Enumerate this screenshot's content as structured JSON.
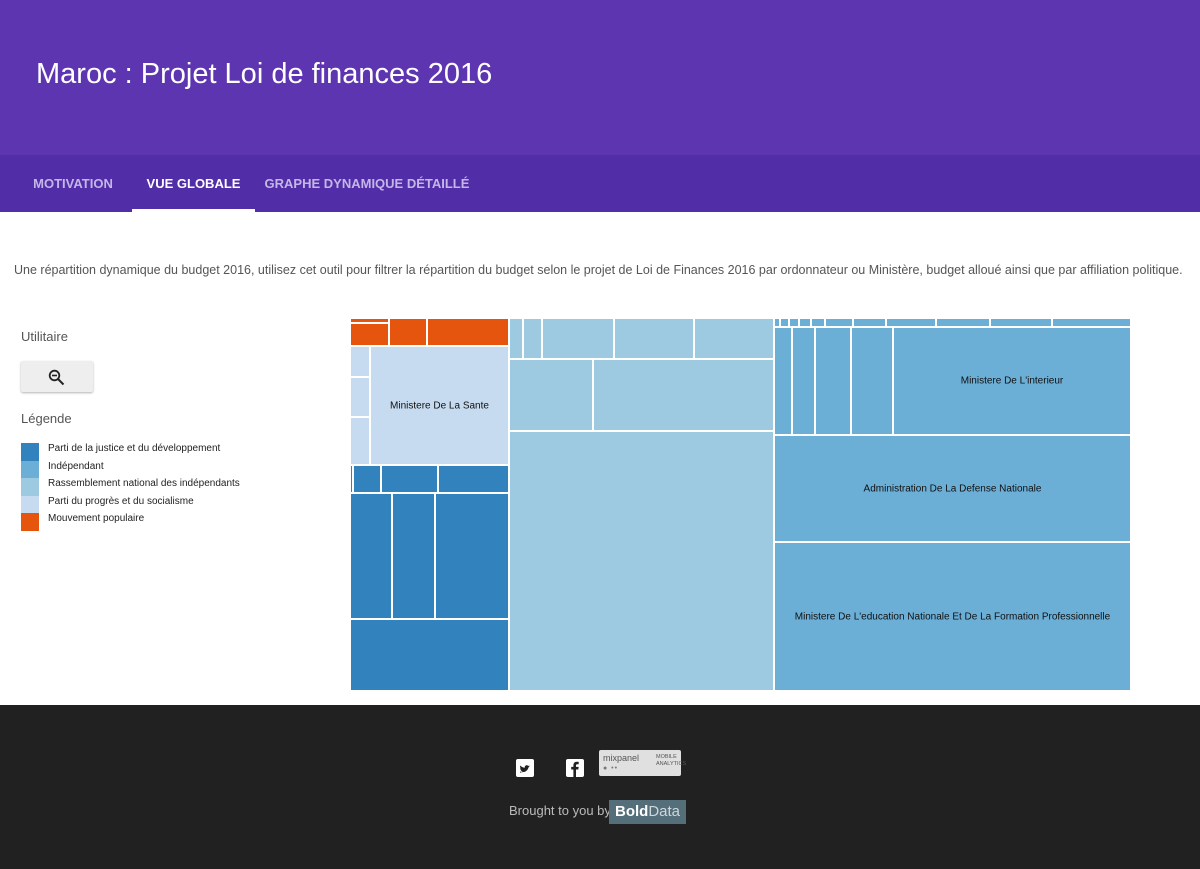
{
  "header": {
    "title": "Maroc : Projet Loi de finances 2016"
  },
  "tabs": [
    {
      "label": "Motivation",
      "active": false
    },
    {
      "label": "Vue globale",
      "active": true
    },
    {
      "label": "Graphe dynamique détaillé",
      "active": false
    }
  ],
  "intro": "Une répartition dynamique du budget 2016, utilisez cet outil pour filtrer la répartition du budget selon le projet de Loi de Finances 2016 par ordonnateur ou Ministère, budget alloué ainsi que par affiliation politique.",
  "sidebar": {
    "utility_title": "Utilitaire",
    "zoom_button_icon": "zoom-out-icon",
    "legend_title": "Légende",
    "legend": [
      {
        "label": "Parti de la justice et du développement",
        "color": "#3182bd"
      },
      {
        "label": "Indépendant",
        "color": "#6baed6"
      },
      {
        "label": "Rassemblement national des indépendants",
        "color": "#9ecae1"
      },
      {
        "label": "Parti du progrès et du socialisme",
        "color": "#c6dbef"
      },
      {
        "label": "Mouvement populaire",
        "color": "#e6550d"
      }
    ]
  },
  "treemap": {
    "labels": {
      "sante": "Ministere De La Sante",
      "interieur": "Ministere De L'interieur",
      "defense": "Administration De La Defense Nationale",
      "education": "Ministere De L'education Nationale Et De La Formation Professionnelle"
    }
  },
  "footer": {
    "twitter_icon": "twitter-icon",
    "facebook_icon": "facebook-icon",
    "mixpanel_name": "mixpanel",
    "mixpanel_sub": "Mobile Analytics",
    "brought_by": "Brought to you by",
    "brand_bold": "Bold",
    "brand_light": "Data"
  }
}
